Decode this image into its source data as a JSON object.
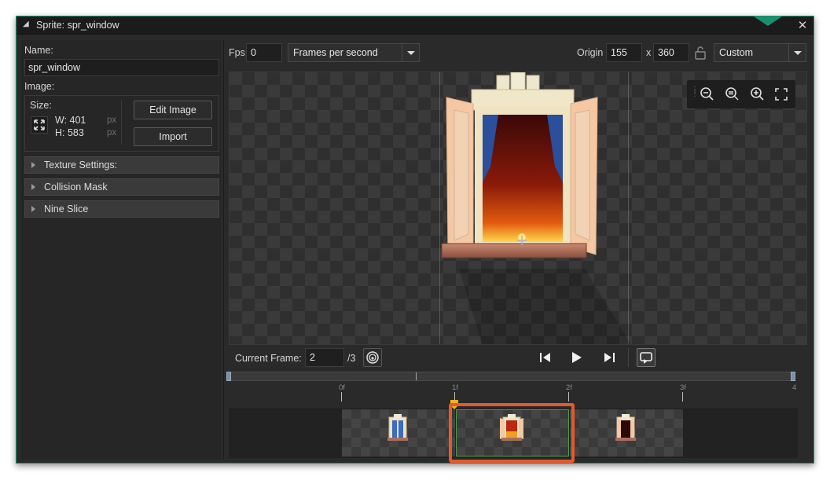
{
  "window": {
    "title": "Sprite: spr_window",
    "close": "✕"
  },
  "left": {
    "name_label": "Name:",
    "name_value": "spr_window",
    "image_label": "Image:",
    "size_label": "Size:",
    "width_text": "W: 401",
    "height_text": "H: 583",
    "unit": "px",
    "edit_image": "Edit Image",
    "import": "Import",
    "sections": [
      "Texture Settings:",
      "Collision Mask",
      "Nine Slice"
    ]
  },
  "toolbar": {
    "fps_label": "Fps",
    "fps_value": "0",
    "speed_mode": "Frames per second",
    "origin_label": "Origin",
    "origin_x": "155",
    "origin_sep": "x",
    "origin_y": "360",
    "origin_mode": "Custom"
  },
  "frame_controls": {
    "current_frame_label": "Current Frame:",
    "current_frame_value": "2",
    "frame_total": "/3"
  },
  "timeline": {
    "tick_labels": [
      "0f",
      "1f",
      "2f",
      "3f",
      "4"
    ],
    "frame_count": 3,
    "selected_frame": 2
  },
  "colors": {
    "accent": "#1a8f6f",
    "selection": "#e8582a",
    "playhead": "#f0b020"
  }
}
